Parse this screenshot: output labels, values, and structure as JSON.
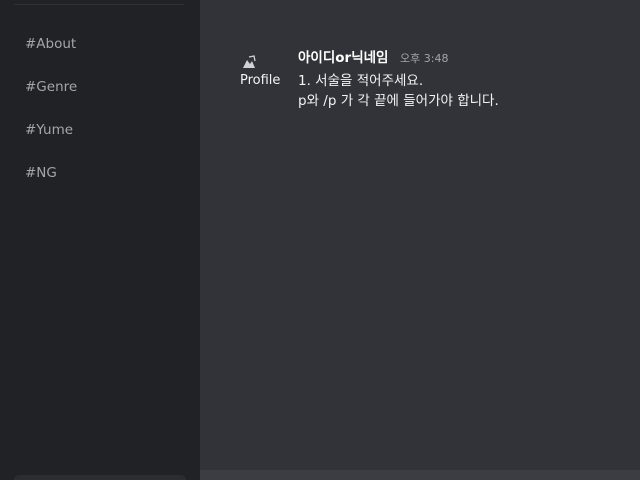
{
  "sidebar": {
    "channels": [
      {
        "label": "#About"
      },
      {
        "label": "#Genre"
      },
      {
        "label": "#Yume"
      },
      {
        "label": "#NG"
      }
    ]
  },
  "message": {
    "avatar_alt": "Profile",
    "author": "아이디or닉네임",
    "timestamp": "오후 3:48",
    "lines": [
      "1. 서술을 적어주세요.",
      "p와 /p 가 각 끝에 들어가야 합니다."
    ]
  },
  "colors": {
    "sidebar_bg": "#202225",
    "main_bg": "#313338",
    "text": "#f2f3f5",
    "muted": "#a3a6ab"
  }
}
